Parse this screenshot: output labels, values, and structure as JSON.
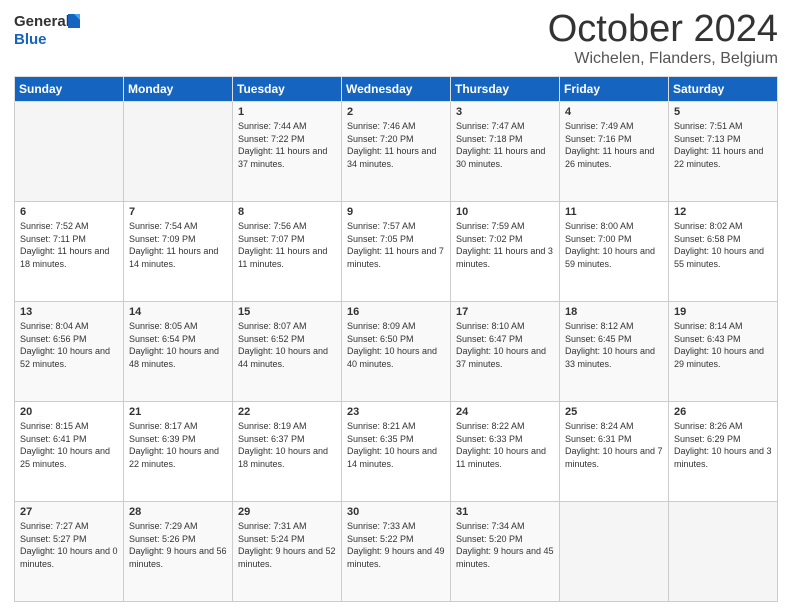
{
  "header": {
    "logo_general": "General",
    "logo_blue": "Blue",
    "month": "October 2024",
    "location": "Wichelen, Flanders, Belgium"
  },
  "weekdays": [
    "Sunday",
    "Monday",
    "Tuesday",
    "Wednesday",
    "Thursday",
    "Friday",
    "Saturday"
  ],
  "rows": [
    [
      {
        "day": "",
        "sunrise": "",
        "sunset": "",
        "daylight": ""
      },
      {
        "day": "",
        "sunrise": "",
        "sunset": "",
        "daylight": ""
      },
      {
        "day": "1",
        "sunrise": "Sunrise: 7:44 AM",
        "sunset": "Sunset: 7:22 PM",
        "daylight": "Daylight: 11 hours and 37 minutes."
      },
      {
        "day": "2",
        "sunrise": "Sunrise: 7:46 AM",
        "sunset": "Sunset: 7:20 PM",
        "daylight": "Daylight: 11 hours and 34 minutes."
      },
      {
        "day": "3",
        "sunrise": "Sunrise: 7:47 AM",
        "sunset": "Sunset: 7:18 PM",
        "daylight": "Daylight: 11 hours and 30 minutes."
      },
      {
        "day": "4",
        "sunrise": "Sunrise: 7:49 AM",
        "sunset": "Sunset: 7:16 PM",
        "daylight": "Daylight: 11 hours and 26 minutes."
      },
      {
        "day": "5",
        "sunrise": "Sunrise: 7:51 AM",
        "sunset": "Sunset: 7:13 PM",
        "daylight": "Daylight: 11 hours and 22 minutes."
      }
    ],
    [
      {
        "day": "6",
        "sunrise": "Sunrise: 7:52 AM",
        "sunset": "Sunset: 7:11 PM",
        "daylight": "Daylight: 11 hours and 18 minutes."
      },
      {
        "day": "7",
        "sunrise": "Sunrise: 7:54 AM",
        "sunset": "Sunset: 7:09 PM",
        "daylight": "Daylight: 11 hours and 14 minutes."
      },
      {
        "day": "8",
        "sunrise": "Sunrise: 7:56 AM",
        "sunset": "Sunset: 7:07 PM",
        "daylight": "Daylight: 11 hours and 11 minutes."
      },
      {
        "day": "9",
        "sunrise": "Sunrise: 7:57 AM",
        "sunset": "Sunset: 7:05 PM",
        "daylight": "Daylight: 11 hours and 7 minutes."
      },
      {
        "day": "10",
        "sunrise": "Sunrise: 7:59 AM",
        "sunset": "Sunset: 7:02 PM",
        "daylight": "Daylight: 11 hours and 3 minutes."
      },
      {
        "day": "11",
        "sunrise": "Sunrise: 8:00 AM",
        "sunset": "Sunset: 7:00 PM",
        "daylight": "Daylight: 10 hours and 59 minutes."
      },
      {
        "day": "12",
        "sunrise": "Sunrise: 8:02 AM",
        "sunset": "Sunset: 6:58 PM",
        "daylight": "Daylight: 10 hours and 55 minutes."
      }
    ],
    [
      {
        "day": "13",
        "sunrise": "Sunrise: 8:04 AM",
        "sunset": "Sunset: 6:56 PM",
        "daylight": "Daylight: 10 hours and 52 minutes."
      },
      {
        "day": "14",
        "sunrise": "Sunrise: 8:05 AM",
        "sunset": "Sunset: 6:54 PM",
        "daylight": "Daylight: 10 hours and 48 minutes."
      },
      {
        "day": "15",
        "sunrise": "Sunrise: 8:07 AM",
        "sunset": "Sunset: 6:52 PM",
        "daylight": "Daylight: 10 hours and 44 minutes."
      },
      {
        "day": "16",
        "sunrise": "Sunrise: 8:09 AM",
        "sunset": "Sunset: 6:50 PM",
        "daylight": "Daylight: 10 hours and 40 minutes."
      },
      {
        "day": "17",
        "sunrise": "Sunrise: 8:10 AM",
        "sunset": "Sunset: 6:47 PM",
        "daylight": "Daylight: 10 hours and 37 minutes."
      },
      {
        "day": "18",
        "sunrise": "Sunrise: 8:12 AM",
        "sunset": "Sunset: 6:45 PM",
        "daylight": "Daylight: 10 hours and 33 minutes."
      },
      {
        "day": "19",
        "sunrise": "Sunrise: 8:14 AM",
        "sunset": "Sunset: 6:43 PM",
        "daylight": "Daylight: 10 hours and 29 minutes."
      }
    ],
    [
      {
        "day": "20",
        "sunrise": "Sunrise: 8:15 AM",
        "sunset": "Sunset: 6:41 PM",
        "daylight": "Daylight: 10 hours and 25 minutes."
      },
      {
        "day": "21",
        "sunrise": "Sunrise: 8:17 AM",
        "sunset": "Sunset: 6:39 PM",
        "daylight": "Daylight: 10 hours and 22 minutes."
      },
      {
        "day": "22",
        "sunrise": "Sunrise: 8:19 AM",
        "sunset": "Sunset: 6:37 PM",
        "daylight": "Daylight: 10 hours and 18 minutes."
      },
      {
        "day": "23",
        "sunrise": "Sunrise: 8:21 AM",
        "sunset": "Sunset: 6:35 PM",
        "daylight": "Daylight: 10 hours and 14 minutes."
      },
      {
        "day": "24",
        "sunrise": "Sunrise: 8:22 AM",
        "sunset": "Sunset: 6:33 PM",
        "daylight": "Daylight: 10 hours and 11 minutes."
      },
      {
        "day": "25",
        "sunrise": "Sunrise: 8:24 AM",
        "sunset": "Sunset: 6:31 PM",
        "daylight": "Daylight: 10 hours and 7 minutes."
      },
      {
        "day": "26",
        "sunrise": "Sunrise: 8:26 AM",
        "sunset": "Sunset: 6:29 PM",
        "daylight": "Daylight: 10 hours and 3 minutes."
      }
    ],
    [
      {
        "day": "27",
        "sunrise": "Sunrise: 7:27 AM",
        "sunset": "Sunset: 5:27 PM",
        "daylight": "Daylight: 10 hours and 0 minutes."
      },
      {
        "day": "28",
        "sunrise": "Sunrise: 7:29 AM",
        "sunset": "Sunset: 5:26 PM",
        "daylight": "Daylight: 9 hours and 56 minutes."
      },
      {
        "day": "29",
        "sunrise": "Sunrise: 7:31 AM",
        "sunset": "Sunset: 5:24 PM",
        "daylight": "Daylight: 9 hours and 52 minutes."
      },
      {
        "day": "30",
        "sunrise": "Sunrise: 7:33 AM",
        "sunset": "Sunset: 5:22 PM",
        "daylight": "Daylight: 9 hours and 49 minutes."
      },
      {
        "day": "31",
        "sunrise": "Sunrise: 7:34 AM",
        "sunset": "Sunset: 5:20 PM",
        "daylight": "Daylight: 9 hours and 45 minutes."
      },
      {
        "day": "",
        "sunrise": "",
        "sunset": "",
        "daylight": ""
      },
      {
        "day": "",
        "sunrise": "",
        "sunset": "",
        "daylight": ""
      }
    ]
  ]
}
